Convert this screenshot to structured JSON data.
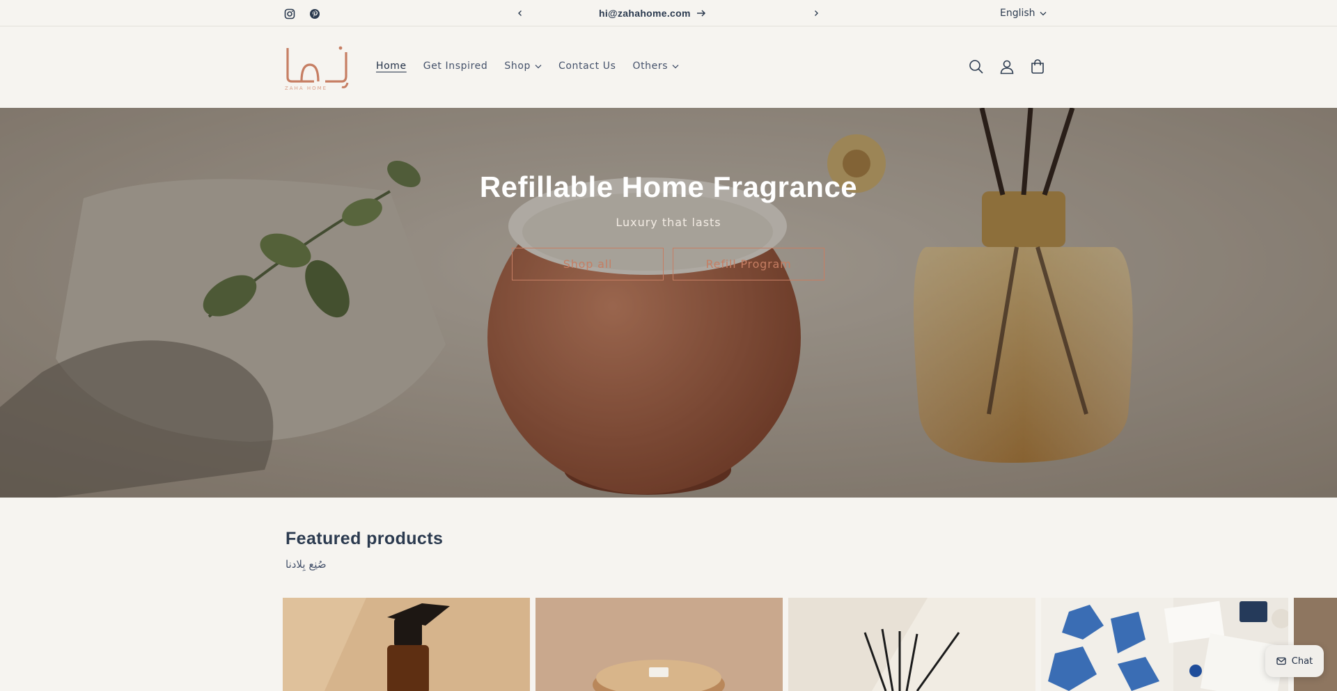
{
  "announcement": {
    "message": "hi@zahahome.com",
    "language": "English"
  },
  "header": {
    "logo_text": "ZAHA HOME",
    "nav": [
      {
        "label": "Home",
        "active": true
      },
      {
        "label": "Get Inspired"
      },
      {
        "label": "Shop",
        "dropdown": true
      },
      {
        "label": "Contact Us"
      },
      {
        "label": "Others",
        "dropdown": true
      }
    ],
    "icons": [
      "search-icon",
      "account-icon",
      "cart-icon"
    ]
  },
  "hero": {
    "title": "Refillable Home Fragrance",
    "subtitle": "Luxury that lasts",
    "buttons": [
      "Shop all",
      "Refill Program"
    ]
  },
  "featured": {
    "title": "Featured products",
    "subtitle": "صُنِع بِلادنا"
  },
  "chat": {
    "label": "Chat"
  },
  "colors": {
    "background": "#f6f4f0",
    "accent": "#c67e63",
    "text": "#2b3a4f"
  }
}
